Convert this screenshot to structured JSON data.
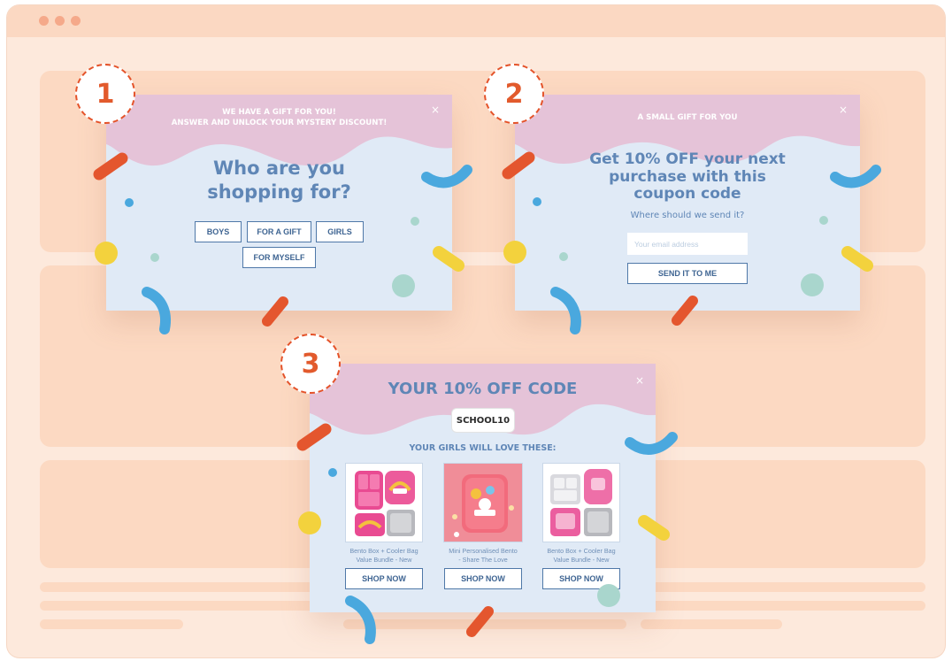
{
  "browser": {
    "dots": [
      "window-dot-1",
      "window-dot-2",
      "window-dot-3"
    ]
  },
  "steps": [
    "1",
    "2",
    "3"
  ],
  "popup1": {
    "top_line_1": "WE HAVE A GIFT FOR YOU!",
    "top_line_2": "ANSWER AND UNLOCK YOUR MYSTERY DISCOUNT!",
    "close": "×",
    "headline_1": "Who are you",
    "headline_2": "shopping for?",
    "options": [
      "BOYS",
      "FOR A GIFT",
      "GIRLS",
      "FOR MYSELF"
    ]
  },
  "popup2": {
    "top_line": "A SMALL GIFT FOR YOU",
    "close": "×",
    "headline_1": "Get 10% OFF your next",
    "headline_2": "purchase with this",
    "headline_3": "coupon code",
    "prompt": "Where should we send it?",
    "email_placeholder": "Your email address",
    "submit": "SEND IT TO ME"
  },
  "popup3": {
    "title": "YOUR 10% OFF CODE",
    "close": "×",
    "code": "SCHOOL10",
    "subtitle": "YOUR GIRLS WILL LOVE THESE:",
    "products": [
      {
        "name_1": "Bento Box + Cooler Bag",
        "name_2": "Value Bundle - New",
        "cta": "SHOP NOW"
      },
      {
        "name_1": "Mini Personalised Bento",
        "name_2": "- Share The Love",
        "cta": "SHOP NOW"
      },
      {
        "name_1": "Bento Box + Cooler Bag",
        "name_2": "Value Bundle - New",
        "cta": "SHOP NOW"
      }
    ]
  },
  "colors": {
    "page_bg": "#fde9dc",
    "block": "#fcd9c2",
    "popup_pink": "#e5c3d8",
    "popup_blue": "#e0eaf6",
    "headline": "#5f86b6",
    "button_border": "#4f78a8",
    "badge": "#e4532a",
    "confetti_orange": "#e4562e",
    "confetti_blue": "#4aa8de",
    "confetti_yellow": "#f3d23d",
    "confetti_teal": "#a9d6cd"
  },
  "icons": [
    "close-icon",
    "confetti-decoration",
    "product-image"
  ]
}
